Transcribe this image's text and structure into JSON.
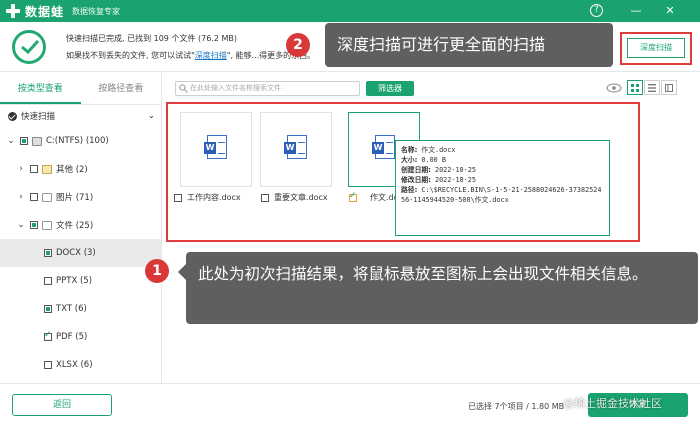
{
  "titlebar": {
    "app_name": "数据蛙",
    "subtitle": "数据恢复专家",
    "help": "?",
    "minimize": "—",
    "close": "✕"
  },
  "status": {
    "line1": "快速扫描已完成, 已找到 109 个文件 (76.2 MB)",
    "line2_prefix": "如果找不到丢失的文件, 您可以试试\"",
    "line2_link": "深度扫描",
    "line2_suffix": "\", 能够...得更多的东西。",
    "deep_scan_button": "深度扫描"
  },
  "sidebar": {
    "tabs": [
      "按类型查看",
      "按路径查看"
    ],
    "quick_scan": "快速扫描",
    "tree": [
      {
        "label": "C:(NTFS) (100)"
      },
      {
        "label": "其他 (2)"
      },
      {
        "label": "图片 (71)"
      },
      {
        "label": "文件 (25)"
      },
      {
        "label": "DOCX (3)"
      },
      {
        "label": "PPTX (5)"
      },
      {
        "label": "TXT (6)"
      },
      {
        "label": "PDF (5)"
      },
      {
        "label": "XLSX (6)"
      }
    ]
  },
  "toolbar": {
    "search_placeholder": "在此处输入文件名称搜索文件",
    "filter_button": "筛选器"
  },
  "files": [
    {
      "name": "工作内容.docx",
      "checked": false
    },
    {
      "name": "重要文章.docx",
      "checked": false
    },
    {
      "name": "作文.docx",
      "checked": true
    }
  ],
  "tooltip": {
    "name_label": "名称:",
    "name": "作文.docx",
    "size_label": "大小:",
    "size": "0.00 B",
    "created_label": "创建日期:",
    "created": "2022-10-25",
    "modified_label": "修改日期:",
    "modified": "2022-10-25",
    "path_label": "路径:",
    "path": "C:\\$RECYCLE.BIN\\S-1-5-21-2588024626-3738252456-1145944520-500\\作文.docx"
  },
  "annotations": {
    "n1": "1",
    "text1": "此处为初次扫描结果，将鼠标悬放至图标上会出现文件相关信息。",
    "n2": "2",
    "text2": "深度扫描可进行更全面的扫描"
  },
  "bottom": {
    "back_button": "返回",
    "selection_info": "已选择 7个项目 / 1.80 MB",
    "recover_button": "恢复"
  },
  "watermark": "@稀土掘金技术社区",
  "colors": {
    "brand": "#1aa36f",
    "highlight_red": "#e03b3b",
    "annotation_bg": "#3c3c3c"
  }
}
